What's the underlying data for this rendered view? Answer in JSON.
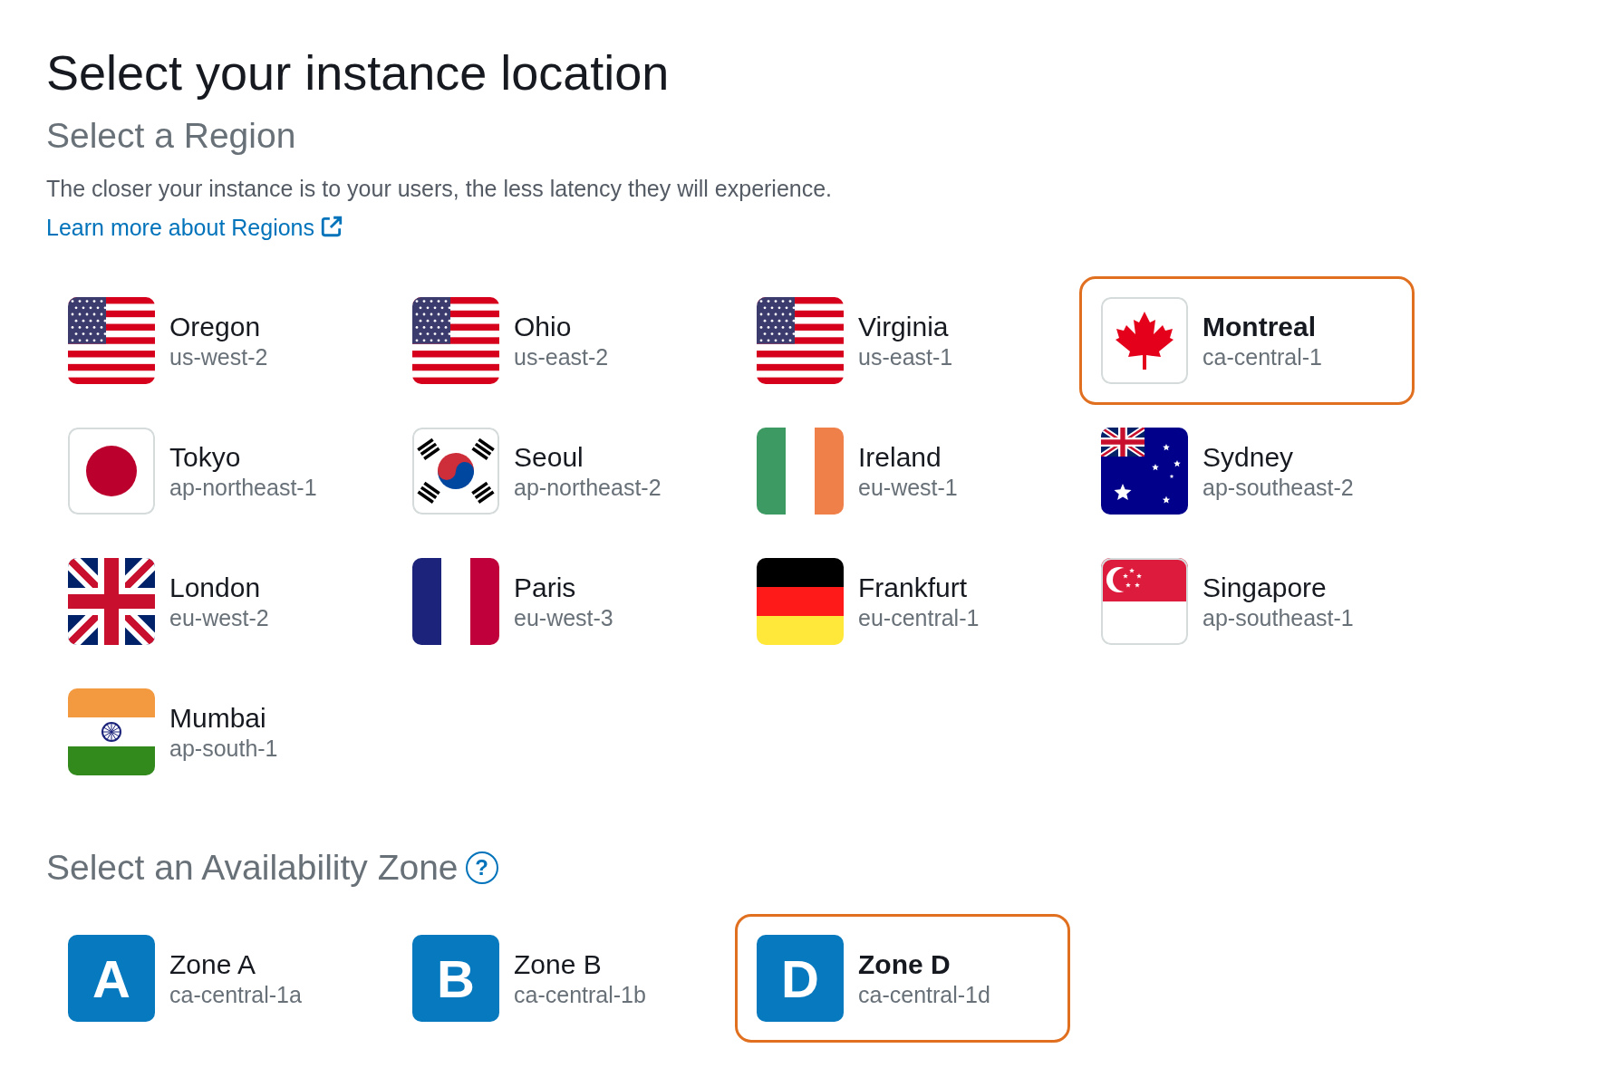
{
  "title": "Select your instance location",
  "region_section": {
    "heading": "Select a Region",
    "description": "The closer your instance is to your users, the less latency they will experience.",
    "link": "Learn more about Regions"
  },
  "regions": [
    {
      "name": "Oregon",
      "code": "us-west-2",
      "kind": "us",
      "selected": false
    },
    {
      "name": "Ohio",
      "code": "us-east-2",
      "kind": "us",
      "selected": false
    },
    {
      "name": "Virginia",
      "code": "us-east-1",
      "kind": "us",
      "selected": false
    },
    {
      "name": "Montreal",
      "code": "ca-central-1",
      "kind": "ca",
      "selected": true
    },
    {
      "name": "Tokyo",
      "code": "ap-northeast-1",
      "kind": "jp",
      "selected": false
    },
    {
      "name": "Seoul",
      "code": "ap-northeast-2",
      "kind": "kr",
      "selected": false
    },
    {
      "name": "Ireland",
      "code": "eu-west-1",
      "kind": "ie",
      "selected": false
    },
    {
      "name": "Sydney",
      "code": "ap-southeast-2",
      "kind": "au",
      "selected": false
    },
    {
      "name": "London",
      "code": "eu-west-2",
      "kind": "gb",
      "selected": false
    },
    {
      "name": "Paris",
      "code": "eu-west-3",
      "kind": "fr",
      "selected": false
    },
    {
      "name": "Frankfurt",
      "code": "eu-central-1",
      "kind": "de",
      "selected": false
    },
    {
      "name": "Singapore",
      "code": "ap-southeast-1",
      "kind": "sg",
      "selected": false
    },
    {
      "name": "Mumbai",
      "code": "ap-south-1",
      "kind": "in",
      "selected": false
    }
  ],
  "zone_section": {
    "heading": "Select an Availability Zone",
    "help_icon": "?"
  },
  "zones": [
    {
      "letter": "A",
      "name": "Zone A",
      "code": "ca-central-1a",
      "selected": false
    },
    {
      "letter": "B",
      "name": "Zone B",
      "code": "ca-central-1b",
      "selected": false
    },
    {
      "letter": "D",
      "name": "Zone D",
      "code": "ca-central-1d",
      "selected": true
    }
  ]
}
